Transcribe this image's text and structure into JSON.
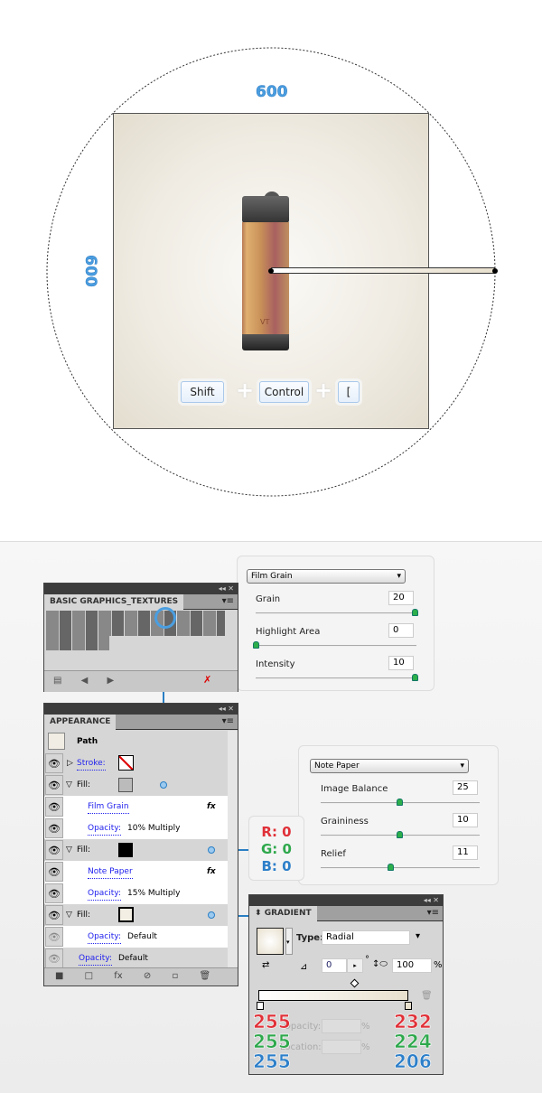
{
  "canvas": {
    "width_label": "600",
    "height_label": "600",
    "shortcut_keys": [
      "Shift",
      "Control",
      "["
    ],
    "shortcut_separator": "+",
    "lighter_logo": "VT"
  },
  "textures_panel": {
    "title": "BASIC GRAPHICS_TEXTURES",
    "collapse": "◂◂",
    "close": "✕"
  },
  "film_grain": {
    "filter": "Film Grain",
    "params": [
      {
        "label": "Grain",
        "value": "20",
        "level": 1.0
      },
      {
        "label": "Highlight Area",
        "value": "0",
        "level": 0.0
      },
      {
        "label": "Intensity",
        "value": "10",
        "level": 1.0
      }
    ]
  },
  "appearance": {
    "title": "APPEARANCE",
    "path_label": "Path",
    "stroke_label": "Stroke:",
    "fill_label": "Fill:",
    "film_grain": "Film Grain",
    "note_paper": "Note Paper",
    "opacity_label": "Opacity:",
    "op1": "10% Multiply",
    "op2": "15% Multiply",
    "op3": "Default",
    "op4": "Default",
    "fx": "fx"
  },
  "note_paper": {
    "filter": "Note Paper",
    "params": [
      {
        "label": "Image Balance",
        "value": "25",
        "level": 0.5
      },
      {
        "label": "Graininess",
        "value": "10",
        "level": 0.5
      },
      {
        "label": "Relief",
        "value": "11",
        "level": 0.44
      }
    ]
  },
  "rgb": {
    "r": "R: 0",
    "g": "G: 0",
    "b": "B: 0"
  },
  "gradient": {
    "title": "GRADIENT",
    "type_label": "Type:",
    "type_value": "Radial",
    "angle": "0",
    "degree": "°",
    "aspect": "100",
    "percent": "%",
    "opacity_label": "Opacity:",
    "location_label": "Location:",
    "left_stop": {
      "r": "255",
      "g": "255",
      "b": "255"
    },
    "right_stop": {
      "r": "232",
      "g": "224",
      "b": "206"
    }
  },
  "colors": {
    "accent": "#2a7fc4",
    "red": "#e03038",
    "green": "#2ea84c",
    "blue": "#2d7fc9"
  }
}
